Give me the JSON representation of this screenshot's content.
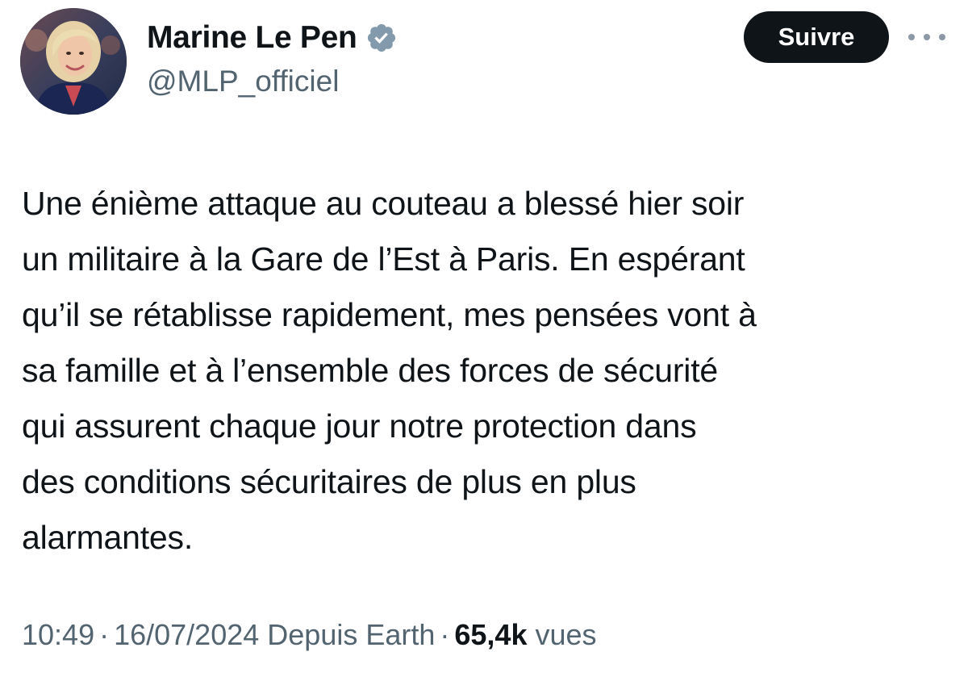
{
  "author": {
    "display_name": "Marine Le Pen",
    "handle": "@MLP_officiel",
    "verified": true
  },
  "follow_button": {
    "label": "Suivre"
  },
  "more_menu": {
    "icon": "more-horizontal-icon"
  },
  "tweet": {
    "text": "Une énième attaque au couteau a blessé  hier soir\nun militaire à la Gare de l’Est à Paris. En espérant\nqu’il se rétablisse rapidement, mes pensées vont à\nsa famille et à l’ensemble des forces de sécurité\nqui assurent chaque jour notre protection dans\ndes conditions sécuritaires de plus en plus\nalarmantes."
  },
  "meta": {
    "time": "10:49",
    "separator": "·",
    "date_source": "16/07/2024 Depuis Earth",
    "views_count": "65,4k",
    "views_label": "vues"
  },
  "colors": {
    "text_primary": "#0f1419",
    "text_secondary": "#536471",
    "button_bg": "#0f1419",
    "verified_badge": "#829aab"
  }
}
